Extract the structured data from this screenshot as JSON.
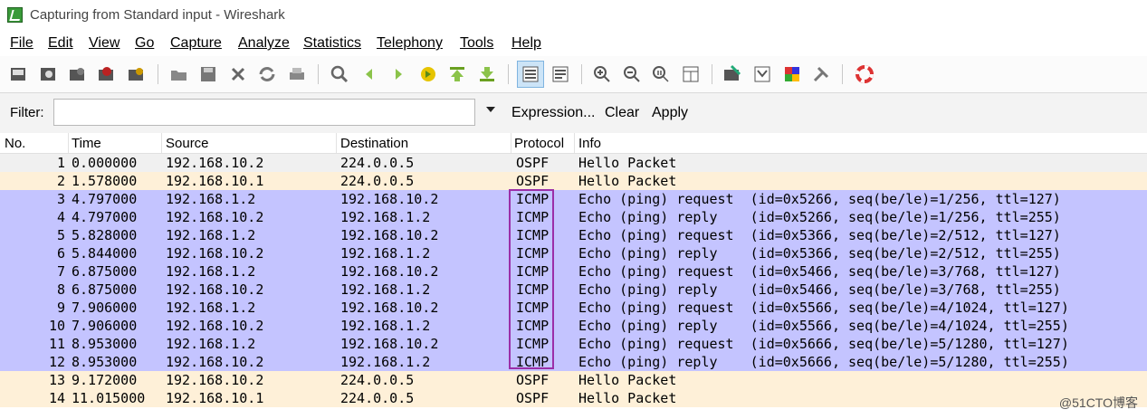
{
  "window": {
    "title": "Capturing from Standard input - Wireshark"
  },
  "menu": [
    "File",
    "Edit",
    "View",
    "Go",
    "Capture",
    "Analyze",
    "Statistics",
    "Telephony",
    "Tools",
    "Help"
  ],
  "toolbar_icons": [
    "interfaces-icon",
    "options-icon",
    "start-icon",
    "stop-icon",
    "restart-icon",
    "open-icon",
    "save-icon",
    "close-icon",
    "reload-icon",
    "print-icon",
    "find-icon",
    "back-icon",
    "forward-icon",
    "goto-icon",
    "first-icon",
    "last-icon",
    "colorize-icon",
    "autoscroll-icon",
    "zoom-in-icon",
    "zoom-out-icon",
    "zoom-normal-icon",
    "resize-columns-icon",
    "capture-filters-icon",
    "display-filters-icon",
    "coloring-rules-icon",
    "preferences-icon",
    "help-icon"
  ],
  "filter": {
    "label": "Filter:",
    "value": "",
    "expression": "Expression...",
    "clear": "Clear",
    "apply": "Apply"
  },
  "columns": [
    "No.",
    "Time",
    "Source",
    "Destination",
    "Protocol",
    "Info"
  ],
  "colors": {
    "ospf_bg": "#fef0d8",
    "ospf_alt_bg": "#f0f0f0",
    "icmp_bg": "#c4c4ff",
    "highlight": "#9b2fa8"
  },
  "packets": [
    {
      "no": "1",
      "time": "0.000000",
      "src": "192.168.10.2",
      "dst": "224.0.0.5",
      "proto": "OSPF",
      "info": "Hello Packet",
      "kind": "ospf-alt"
    },
    {
      "no": "2",
      "time": "1.578000",
      "src": "192.168.10.1",
      "dst": "224.0.0.5",
      "proto": "OSPF",
      "info": "Hello Packet",
      "kind": "ospf"
    },
    {
      "no": "3",
      "time": "4.797000",
      "src": "192.168.1.2",
      "dst": "192.168.10.2",
      "proto": "ICMP",
      "info": "Echo (ping) request  (id=0x5266, seq(be/le)=1/256, ttl=127)",
      "kind": "icmp"
    },
    {
      "no": "4",
      "time": "4.797000",
      "src": "192.168.10.2",
      "dst": "192.168.1.2",
      "proto": "ICMP",
      "info": "Echo (ping) reply    (id=0x5266, seq(be/le)=1/256, ttl=255)",
      "kind": "icmp"
    },
    {
      "no": "5",
      "time": "5.828000",
      "src": "192.168.1.2",
      "dst": "192.168.10.2",
      "proto": "ICMP",
      "info": "Echo (ping) request  (id=0x5366, seq(be/le)=2/512, ttl=127)",
      "kind": "icmp"
    },
    {
      "no": "6",
      "time": "5.844000",
      "src": "192.168.10.2",
      "dst": "192.168.1.2",
      "proto": "ICMP",
      "info": "Echo (ping) reply    (id=0x5366, seq(be/le)=2/512, ttl=255)",
      "kind": "icmp"
    },
    {
      "no": "7",
      "time": "6.875000",
      "src": "192.168.1.2",
      "dst": "192.168.10.2",
      "proto": "ICMP",
      "info": "Echo (ping) request  (id=0x5466, seq(be/le)=3/768, ttl=127)",
      "kind": "icmp"
    },
    {
      "no": "8",
      "time": "6.875000",
      "src": "192.168.10.2",
      "dst": "192.168.1.2",
      "proto": "ICMP",
      "info": "Echo (ping) reply    (id=0x5466, seq(be/le)=3/768, ttl=255)",
      "kind": "icmp"
    },
    {
      "no": "9",
      "time": "7.906000",
      "src": "192.168.1.2",
      "dst": "192.168.10.2",
      "proto": "ICMP",
      "info": "Echo (ping) request  (id=0x5566, seq(be/le)=4/1024, ttl=127)",
      "kind": "icmp"
    },
    {
      "no": "10",
      "time": "7.906000",
      "src": "192.168.10.2",
      "dst": "192.168.1.2",
      "proto": "ICMP",
      "info": "Echo (ping) reply    (id=0x5566, seq(be/le)=4/1024, ttl=255)",
      "kind": "icmp"
    },
    {
      "no": "11",
      "time": "8.953000",
      "src": "192.168.1.2",
      "dst": "192.168.10.2",
      "proto": "ICMP",
      "info": "Echo (ping) request  (id=0x5666, seq(be/le)=5/1280, ttl=127)",
      "kind": "icmp"
    },
    {
      "no": "12",
      "time": "8.953000",
      "src": "192.168.10.2",
      "dst": "192.168.1.2",
      "proto": "ICMP",
      "info": "Echo (ping) reply    (id=0x5666, seq(be/le)=5/1280, ttl=255)",
      "kind": "icmp"
    },
    {
      "no": "13",
      "time": "9.172000",
      "src": "192.168.10.2",
      "dst": "224.0.0.5",
      "proto": "OSPF",
      "info": "Hello Packet",
      "kind": "ospf"
    },
    {
      "no": "14",
      "time": "11.015000",
      "src": "192.168.10.1",
      "dst": "224.0.0.5",
      "proto": "OSPF",
      "info": "Hello Packet",
      "kind": "ospf"
    }
  ],
  "watermark": "@51CTO博客"
}
